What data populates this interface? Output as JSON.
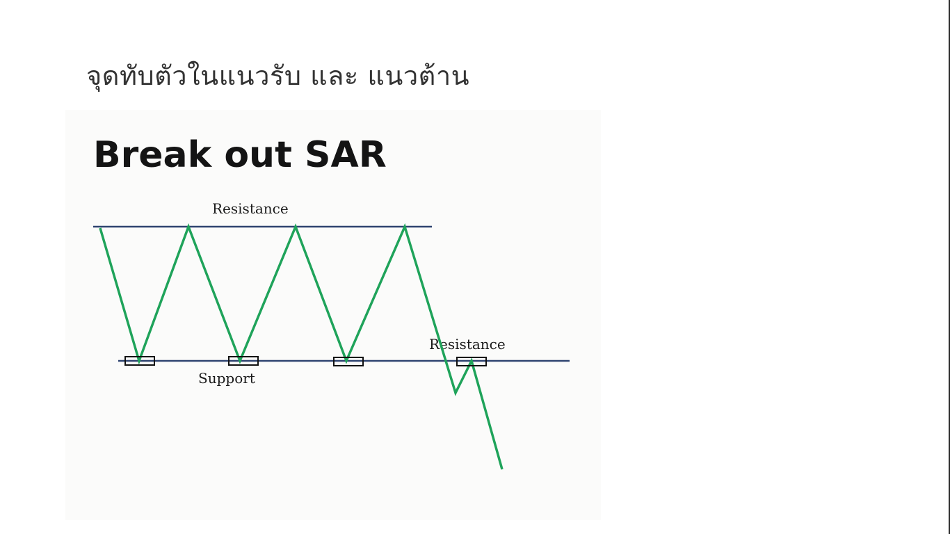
{
  "slide": {
    "title": "จุดทับตัวในแนวรับ และ แนวต้าน"
  },
  "figure": {
    "heading": "Break out SAR",
    "labels": {
      "top_resistance": "Resistance",
      "support": "Support",
      "new_resistance": "Resistance"
    },
    "colors": {
      "price_line": "#1fa35a",
      "level_line": "#2f4470",
      "sar_box_stroke": "#111111"
    }
  }
}
